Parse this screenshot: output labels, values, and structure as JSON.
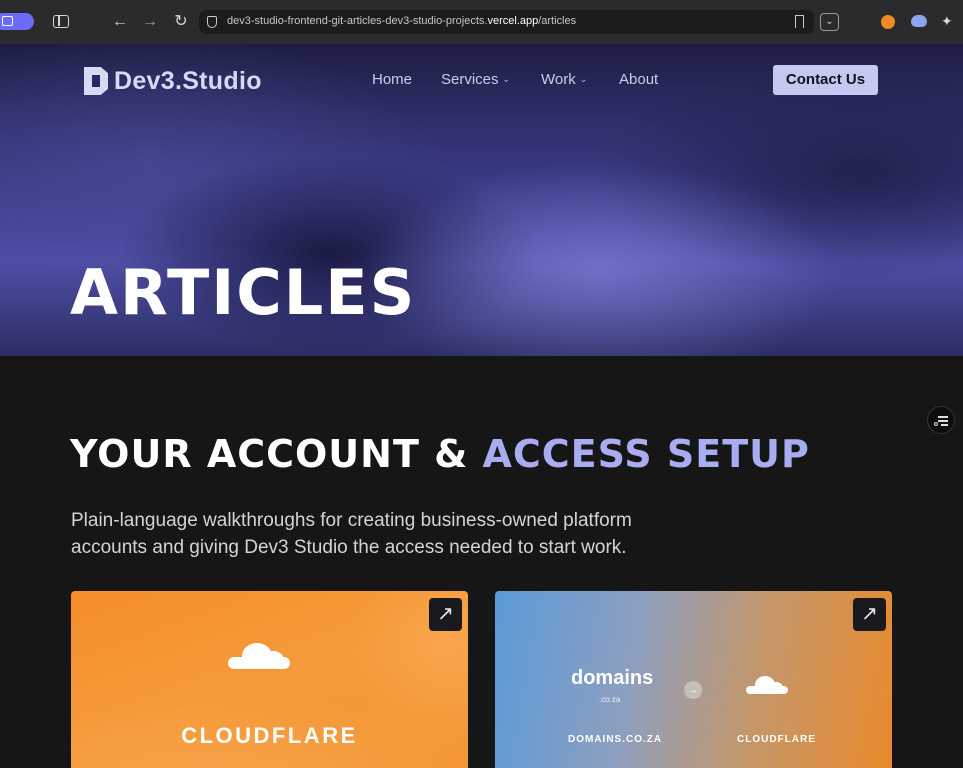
{
  "browser": {
    "url_prefix": "dev3-studio-frontend-git-articles-dev3-studio-projects.",
    "url_host": "vercel.app",
    "url_path": "/articles"
  },
  "site": {
    "logo_text": "Dev3.Studio",
    "nav": {
      "home": "Home",
      "services": "Services",
      "work": "Work",
      "about": "About"
    },
    "contact_label": "Contact Us"
  },
  "hero": {
    "title": "ARTICLES"
  },
  "section": {
    "title_main": "YOUR ACCOUNT & ",
    "title_accent": "ACCESS SETUP",
    "description": "Plain-language walkthroughs for creating business-owned platform accounts and giving Dev3 Studio the access needed to start work."
  },
  "cards": {
    "cloudflare": {
      "label": "CLOUDFLARE"
    },
    "domains": {
      "wordmark": "domains",
      "wordmark_sub": ".co.za",
      "left_label": "DOMAINS.CO.ZA",
      "right_label": "CLOUDFLARE"
    }
  },
  "icons": {
    "arrow": "↗",
    "back": "←",
    "forward": "→",
    "reload": "↻",
    "chevron": "⌄",
    "right_arrow": "→"
  },
  "colors": {
    "accent": "#a9acf0",
    "contact_bg": "#c6c8f1",
    "cloudflare_orange": "#f58d2a"
  }
}
